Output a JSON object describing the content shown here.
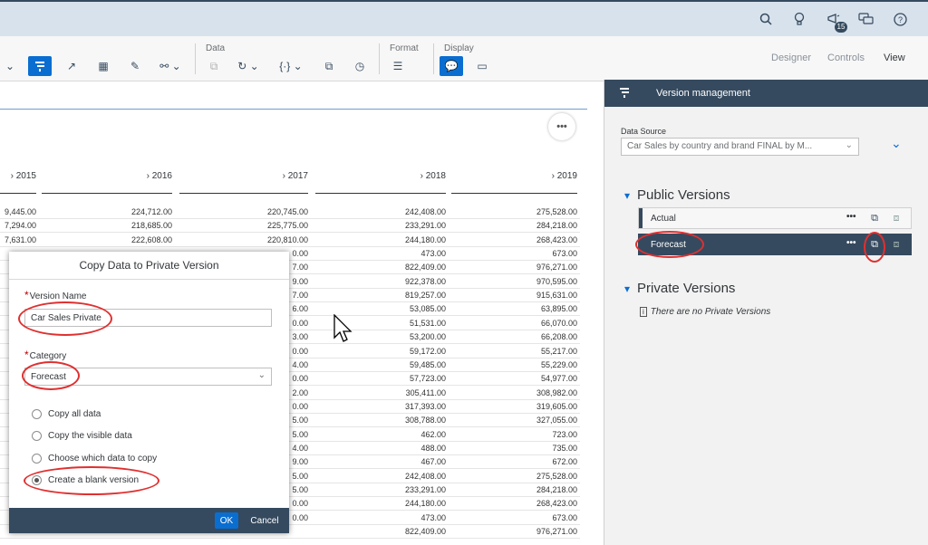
{
  "shell": {
    "notification_count": "15",
    "icons": [
      "search-icon",
      "lightbulb-icon",
      "notifications-icon",
      "chat-icon",
      "help-icon"
    ]
  },
  "toolbar": {
    "groups": {
      "data": "Data",
      "format": "Format",
      "display": "Display"
    },
    "view_tabs": {
      "designer": "Designer",
      "controls": "Controls",
      "view": "View"
    }
  },
  "grid": {
    "columns": [
      "2015",
      "2016",
      "2017",
      "2018",
      "2019"
    ],
    "rows": [
      [
        "9,445.00",
        "224,712.00",
        "220,745.00",
        "242,408.00",
        "275,528.00"
      ],
      [
        "7,294.00",
        "218,685.00",
        "225,775.00",
        "233,291.00",
        "284,218.00"
      ],
      [
        "7,631.00",
        "222,608.00",
        "220,810.00",
        "244,180.00",
        "268,423.00"
      ],
      [
        "",
        "",
        "0.00",
        "473.00",
        "673.00"
      ],
      [
        "",
        "",
        "7.00",
        "822,409.00",
        "976,271.00"
      ],
      [
        "",
        "",
        "9.00",
        "922,378.00",
        "970,595.00"
      ],
      [
        "",
        "",
        "7.00",
        "819,257.00",
        "915,631.00"
      ],
      [
        "",
        "",
        "6.00",
        "53,085.00",
        "63,895.00"
      ],
      [
        "",
        "",
        "0.00",
        "51,531.00",
        "66,070.00"
      ],
      [
        "",
        "",
        "3.00",
        "53,200.00",
        "66,208.00"
      ],
      [
        "",
        "",
        "0.00",
        "59,172.00",
        "55,217.00"
      ],
      [
        "",
        "",
        "4.00",
        "59,485.00",
        "55,229.00"
      ],
      [
        "",
        "",
        "0.00",
        "57,723.00",
        "54,977.00"
      ],
      [
        "",
        "",
        "2.00",
        "305,411.00",
        "308,982.00"
      ],
      [
        "",
        "",
        "0.00",
        "317,393.00",
        "319,605.00"
      ],
      [
        "",
        "",
        "5.00",
        "308,788.00",
        "327,055.00"
      ],
      [
        "",
        "",
        "5.00",
        "462.00",
        "723.00"
      ],
      [
        "",
        "",
        "4.00",
        "488.00",
        "735.00"
      ],
      [
        "",
        "",
        "9.00",
        "467.00",
        "672.00"
      ],
      [
        "",
        "",
        "5.00",
        "242,408.00",
        "275,528.00"
      ],
      [
        "",
        "",
        "5.00",
        "233,291.00",
        "284,218.00"
      ],
      [
        "",
        "",
        "0.00",
        "244,180.00",
        "268,423.00"
      ],
      [
        "",
        "",
        "0.00",
        "473.00",
        "673.00"
      ],
      [
        "",
        "",
        "",
        "822,409.00",
        "976,271.00"
      ]
    ]
  },
  "panel": {
    "title": "Version management",
    "data_source_label": "Data Source",
    "data_source_value": "Car Sales by country and brand FINAL by M...",
    "public_title": "Public Versions",
    "public_versions": [
      {
        "name": "Actual",
        "selected": false
      },
      {
        "name": "Forecast",
        "selected": true
      }
    ],
    "private_title": "Private Versions",
    "no_private": "There are no Private Versions",
    "more_label": "•••"
  },
  "dialog": {
    "title": "Copy Data to Private Version",
    "version_name_label": "Version Name",
    "version_name_value": "Car Sales Private",
    "category_label": "Category",
    "category_value": "Forecast",
    "options": [
      {
        "label": "Copy all data",
        "checked": false
      },
      {
        "label": "Copy the visible data",
        "checked": false
      },
      {
        "label": "Choose which data to copy",
        "checked": false
      },
      {
        "label": "Create a blank version",
        "checked": true
      }
    ],
    "ok_label": "OK",
    "cancel_label": "Cancel"
  },
  "colors": {
    "shell_bg": "#d8e2ec",
    "panel_header": "#354a5f",
    "accent": "#0a6ed1",
    "highlight": "#e03030"
  }
}
